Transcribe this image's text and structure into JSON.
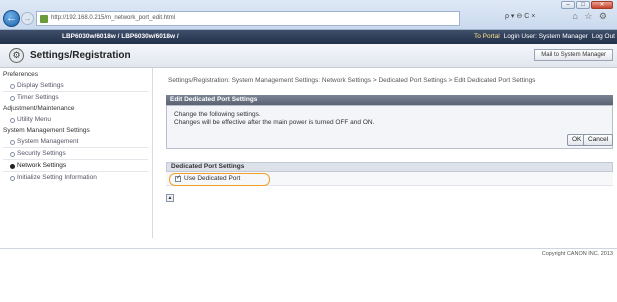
{
  "browser": {
    "url": "http://192.168.0.215/m_network_port_edit.html",
    "search": "ρ ▾ ⊖ C ×",
    "window_controls": [
      "–",
      "□",
      "✕"
    ],
    "toolbar_icons": "⌂ ☆ ⚙"
  },
  "device": {
    "name": "LBP6030w/6018w / LBP6030w/6018w /",
    "portal_link": "To Portal",
    "login_user": "Login User: System Manager",
    "logout": "Log Out"
  },
  "header": {
    "title": "Settings/Registration",
    "mail_button": "Mail to System Manager"
  },
  "sidebar": {
    "groups": [
      {
        "label": "Preferences",
        "items": [
          "Display Settings",
          "Timer Settings"
        ]
      },
      {
        "label": "Adjustment/Maintenance",
        "items": [
          "Utility Menu"
        ]
      },
      {
        "label": "System Management Settings",
        "items": [
          "System Management",
          "Security Settings",
          "Network Settings",
          "Initialize Setting Information"
        ]
      }
    ],
    "active": "Network Settings"
  },
  "main": {
    "breadcrumb": "Settings/Registration: System Management Settings: Network Settings > Dedicated Port Settings > Edit Dedicated Port Settings",
    "edit_panel": {
      "title": "Edit Dedicated Port Settings",
      "message_1": "Change the following settings.",
      "message_2": "Changes will be effective after the main power is turned OFF and ON.",
      "ok_label": "OK",
      "cancel_label": "Cancel"
    },
    "section": {
      "title": "Dedicated Port Settings",
      "checkbox_label": "Use Dedicated Port",
      "checkbox_checked": true
    },
    "top_icon": "▲"
  },
  "footer": {
    "copyright": "Copyright CANON INC. 2013"
  },
  "colors": {
    "device_bar": "#2b3a55",
    "panel_header": "#6a7383",
    "highlight": "#f2a026"
  }
}
